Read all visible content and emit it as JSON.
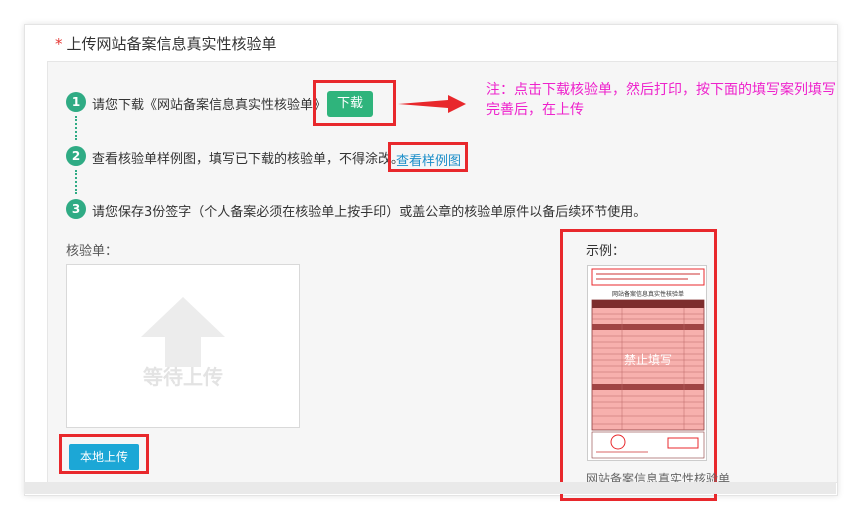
{
  "section": {
    "required_mark": "*",
    "title": "上传网站备案信息真实性核验单"
  },
  "steps": [
    {
      "num": "1",
      "text": "请您下载《网站备案信息真实性核验单》"
    },
    {
      "num": "2",
      "text": "查看核验单样例图，填写已下载的核验单，不得涂改。"
    },
    {
      "num": "3",
      "text": "请您保存3份签字（个人备案必须在核验单上按手印）或盖公章的核验单原件以备后续环节使用。"
    }
  ],
  "buttons": {
    "download": "下载",
    "view_sample": "查看样例图",
    "local_upload": "本地上传"
  },
  "annotation_note": "注：点击下载核验单，然后打印，按下面的填写案列填写完善后，在上传",
  "upload": {
    "label": "核验单：",
    "placeholder": "等待上传"
  },
  "example": {
    "label": "示例：",
    "doc_title": "网站备案信息真实性核验单",
    "watermark": "禁止填写",
    "caption": "网站备案信息真实性核验单"
  },
  "colors": {
    "accent_green": "#2fab84",
    "download_btn": "#2fb47c",
    "upload_btn": "#1ca7d6",
    "highlight_red": "#e8282c",
    "note_magenta": "#ee22cc"
  }
}
